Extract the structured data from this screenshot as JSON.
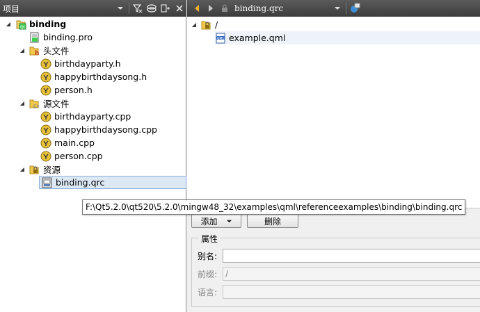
{
  "left_panel": {
    "title": "项目",
    "project_name": "binding",
    "tree": [
      {
        "label": "binding.pro"
      },
      {
        "label": "头文件"
      },
      {
        "label": "birthdayparty.h"
      },
      {
        "label": "happybirthdaysong.h"
      },
      {
        "label": "person.h"
      },
      {
        "label": "源文件"
      },
      {
        "label": "birthdayparty.cpp"
      },
      {
        "label": "happybirthdaysong.cpp"
      },
      {
        "label": "main.cpp"
      },
      {
        "label": "person.cpp"
      },
      {
        "label": "资源"
      },
      {
        "label": "binding.qrc"
      }
    ]
  },
  "right_panel": {
    "file_combo": "binding.qrc",
    "prefix_node": "/",
    "file_node": "example.qml",
    "add_button": "添加",
    "delete_button": "删除",
    "group_title": "属性",
    "alias_label": "别名:",
    "alias_value": "",
    "prefix_label": "前缀:",
    "prefix_value": "/",
    "language_label": "语言:",
    "language_value": ""
  },
  "tooltip": "F:\\Qt5.2.0\\qt520\\5.2.0\\mingw48_32\\examples\\qml\\referenceexamples\\binding\\binding.qrc",
  "colors": {
    "toolbar": "#4a4a4a",
    "selection": "#dde8f5",
    "selection_border": "#8cb0dc",
    "folder_yellow": "#f2c94c"
  }
}
